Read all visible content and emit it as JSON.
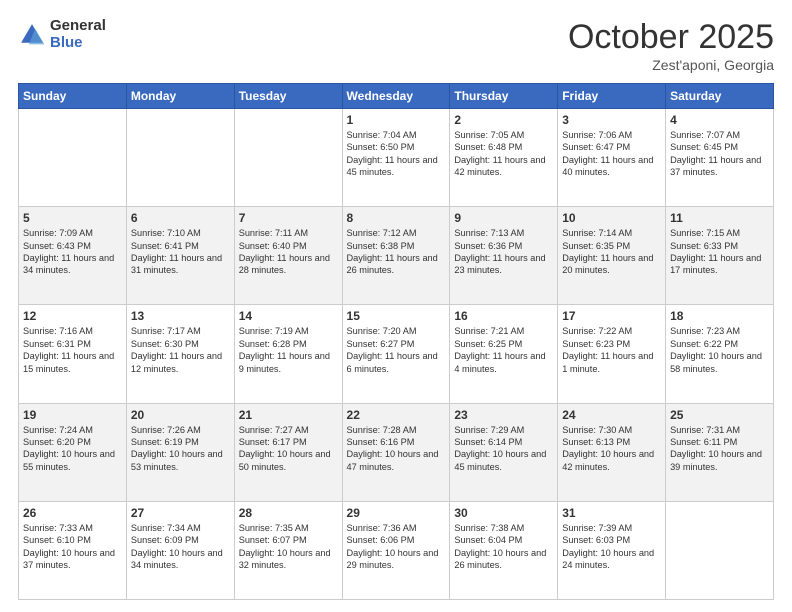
{
  "header": {
    "logo_general": "General",
    "logo_blue": "Blue",
    "month_title": "October 2025",
    "location": "Zest'aponi, Georgia"
  },
  "weekdays": [
    "Sunday",
    "Monday",
    "Tuesday",
    "Wednesday",
    "Thursday",
    "Friday",
    "Saturday"
  ],
  "weeks": [
    [
      {
        "day": "",
        "info": ""
      },
      {
        "day": "",
        "info": ""
      },
      {
        "day": "",
        "info": ""
      },
      {
        "day": "1",
        "info": "Sunrise: 7:04 AM\nSunset: 6:50 PM\nDaylight: 11 hours and 45 minutes."
      },
      {
        "day": "2",
        "info": "Sunrise: 7:05 AM\nSunset: 6:48 PM\nDaylight: 11 hours and 42 minutes."
      },
      {
        "day": "3",
        "info": "Sunrise: 7:06 AM\nSunset: 6:47 PM\nDaylight: 11 hours and 40 minutes."
      },
      {
        "day": "4",
        "info": "Sunrise: 7:07 AM\nSunset: 6:45 PM\nDaylight: 11 hours and 37 minutes."
      }
    ],
    [
      {
        "day": "5",
        "info": "Sunrise: 7:09 AM\nSunset: 6:43 PM\nDaylight: 11 hours and 34 minutes."
      },
      {
        "day": "6",
        "info": "Sunrise: 7:10 AM\nSunset: 6:41 PM\nDaylight: 11 hours and 31 minutes."
      },
      {
        "day": "7",
        "info": "Sunrise: 7:11 AM\nSunset: 6:40 PM\nDaylight: 11 hours and 28 minutes."
      },
      {
        "day": "8",
        "info": "Sunrise: 7:12 AM\nSunset: 6:38 PM\nDaylight: 11 hours and 26 minutes."
      },
      {
        "day": "9",
        "info": "Sunrise: 7:13 AM\nSunset: 6:36 PM\nDaylight: 11 hours and 23 minutes."
      },
      {
        "day": "10",
        "info": "Sunrise: 7:14 AM\nSunset: 6:35 PM\nDaylight: 11 hours and 20 minutes."
      },
      {
        "day": "11",
        "info": "Sunrise: 7:15 AM\nSunset: 6:33 PM\nDaylight: 11 hours and 17 minutes."
      }
    ],
    [
      {
        "day": "12",
        "info": "Sunrise: 7:16 AM\nSunset: 6:31 PM\nDaylight: 11 hours and 15 minutes."
      },
      {
        "day": "13",
        "info": "Sunrise: 7:17 AM\nSunset: 6:30 PM\nDaylight: 11 hours and 12 minutes."
      },
      {
        "day": "14",
        "info": "Sunrise: 7:19 AM\nSunset: 6:28 PM\nDaylight: 11 hours and 9 minutes."
      },
      {
        "day": "15",
        "info": "Sunrise: 7:20 AM\nSunset: 6:27 PM\nDaylight: 11 hours and 6 minutes."
      },
      {
        "day": "16",
        "info": "Sunrise: 7:21 AM\nSunset: 6:25 PM\nDaylight: 11 hours and 4 minutes."
      },
      {
        "day": "17",
        "info": "Sunrise: 7:22 AM\nSunset: 6:23 PM\nDaylight: 11 hours and 1 minute."
      },
      {
        "day": "18",
        "info": "Sunrise: 7:23 AM\nSunset: 6:22 PM\nDaylight: 10 hours and 58 minutes."
      }
    ],
    [
      {
        "day": "19",
        "info": "Sunrise: 7:24 AM\nSunset: 6:20 PM\nDaylight: 10 hours and 55 minutes."
      },
      {
        "day": "20",
        "info": "Sunrise: 7:26 AM\nSunset: 6:19 PM\nDaylight: 10 hours and 53 minutes."
      },
      {
        "day": "21",
        "info": "Sunrise: 7:27 AM\nSunset: 6:17 PM\nDaylight: 10 hours and 50 minutes."
      },
      {
        "day": "22",
        "info": "Sunrise: 7:28 AM\nSunset: 6:16 PM\nDaylight: 10 hours and 47 minutes."
      },
      {
        "day": "23",
        "info": "Sunrise: 7:29 AM\nSunset: 6:14 PM\nDaylight: 10 hours and 45 minutes."
      },
      {
        "day": "24",
        "info": "Sunrise: 7:30 AM\nSunset: 6:13 PM\nDaylight: 10 hours and 42 minutes."
      },
      {
        "day": "25",
        "info": "Sunrise: 7:31 AM\nSunset: 6:11 PM\nDaylight: 10 hours and 39 minutes."
      }
    ],
    [
      {
        "day": "26",
        "info": "Sunrise: 7:33 AM\nSunset: 6:10 PM\nDaylight: 10 hours and 37 minutes."
      },
      {
        "day": "27",
        "info": "Sunrise: 7:34 AM\nSunset: 6:09 PM\nDaylight: 10 hours and 34 minutes."
      },
      {
        "day": "28",
        "info": "Sunrise: 7:35 AM\nSunset: 6:07 PM\nDaylight: 10 hours and 32 minutes."
      },
      {
        "day": "29",
        "info": "Sunrise: 7:36 AM\nSunset: 6:06 PM\nDaylight: 10 hours and 29 minutes."
      },
      {
        "day": "30",
        "info": "Sunrise: 7:38 AM\nSunset: 6:04 PM\nDaylight: 10 hours and 26 minutes."
      },
      {
        "day": "31",
        "info": "Sunrise: 7:39 AM\nSunset: 6:03 PM\nDaylight: 10 hours and 24 minutes."
      },
      {
        "day": "",
        "info": ""
      }
    ]
  ]
}
